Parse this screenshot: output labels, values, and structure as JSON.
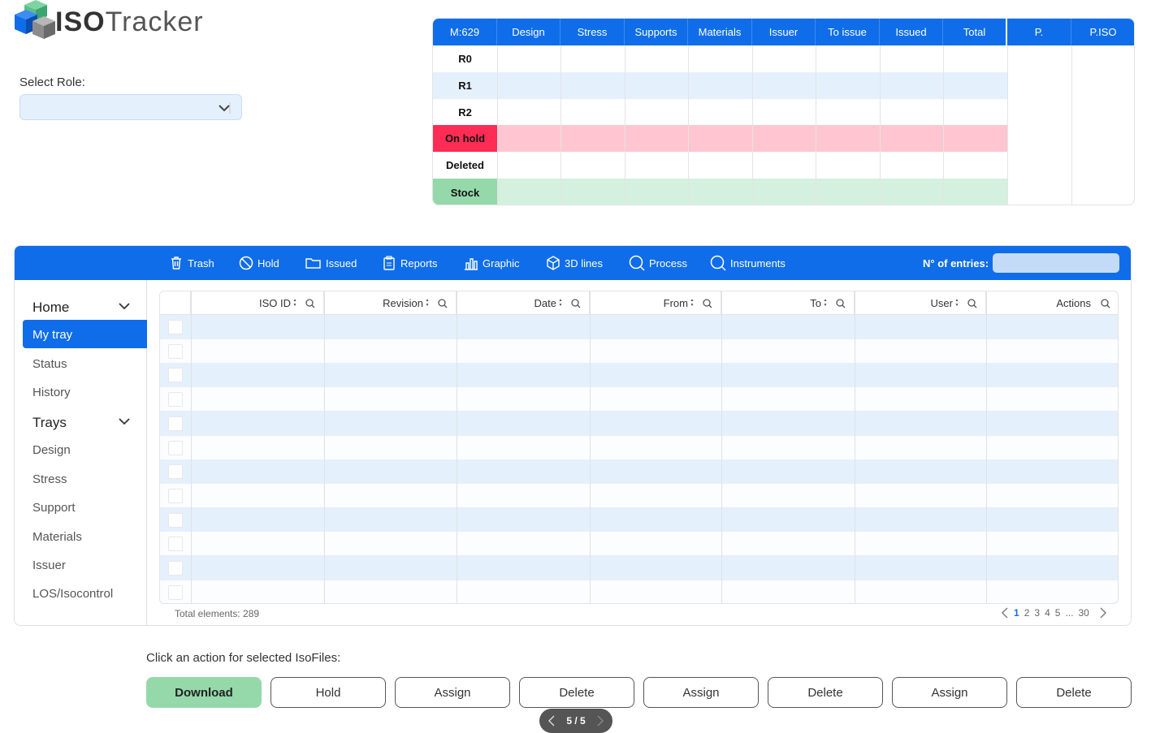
{
  "app": {
    "logo_bold": "ISO",
    "logo_light": "Tracker"
  },
  "role": {
    "label": "Select Role:",
    "value": ""
  },
  "summary": {
    "headers": [
      "M:629",
      "Design",
      "Stress",
      "Supports",
      "Materials",
      "Issuer",
      "To issue",
      "Issued",
      "Total",
      "P.",
      "P.ISO"
    ],
    "rows": [
      {
        "label": "R0",
        "bg": "#ffffff",
        "label_bg": "#ffffff",
        "label_color": "#111111"
      },
      {
        "label": "R1",
        "bg": "#e5f0fd",
        "label_bg": "#e5f0fd",
        "label_color": "#111111"
      },
      {
        "label": "R2",
        "bg": "#ffffff",
        "label_bg": "#ffffff",
        "label_color": "#111111"
      },
      {
        "label": "On hold",
        "bg": "#ffc6d2",
        "label_bg": "#ff2c55",
        "label_color": "#111111"
      },
      {
        "label": "Deleted",
        "bg": "#ffffff",
        "label_bg": "#ffffff",
        "label_color": "#111111"
      },
      {
        "label": "Stock",
        "bg": "#d4f0de",
        "label_bg": "#95d9ab",
        "label_color": "#111111"
      }
    ]
  },
  "toolbar": {
    "items": [
      {
        "label": "Trash",
        "icon": "trash-icon"
      },
      {
        "label": "Hold",
        "icon": "hold-icon"
      },
      {
        "label": "Issued",
        "icon": "folder-icon"
      },
      {
        "label": "Reports",
        "icon": "clipboard-icon"
      },
      {
        "label": "Graphic",
        "icon": "bar-chart-icon"
      },
      {
        "label": "3D lines",
        "icon": "cube-icon"
      },
      {
        "label": "Process",
        "icon": "search-icon"
      },
      {
        "label": "Instruments",
        "icon": "search-icon"
      }
    ],
    "entries_label": "N° of entries:",
    "entries_value": ""
  },
  "sidebar": {
    "home": "Home",
    "home_items": [
      "My tray",
      "Status",
      "History"
    ],
    "trays": "Trays",
    "tray_items": [
      "Design",
      "Stress",
      "Support",
      "Materials",
      "Issuer",
      "LOS/Isocontrol"
    ]
  },
  "grid": {
    "columns": [
      "ISO ID",
      "Revision",
      "Date",
      "From",
      "To",
      "User",
      "Actions"
    ],
    "row_count": 12,
    "total_text": "Total elements: 289",
    "pages": [
      "1",
      "2",
      "3",
      "4",
      "5",
      "...",
      "30"
    ],
    "current_page": "1"
  },
  "actions": {
    "prompt": "Click an action for selected IsoFiles:",
    "buttons": [
      "Download",
      "Hold",
      "Assign",
      "Delete",
      "Assign",
      "Delete",
      "Assign",
      "Delete"
    ]
  },
  "page_indicator": "5 / 5",
  "colors": {
    "primary": "#0f6dea",
    "row_alt": "#e5f0fd",
    "hold_red": "#ff2c55",
    "stock_green": "#95d9ab"
  }
}
